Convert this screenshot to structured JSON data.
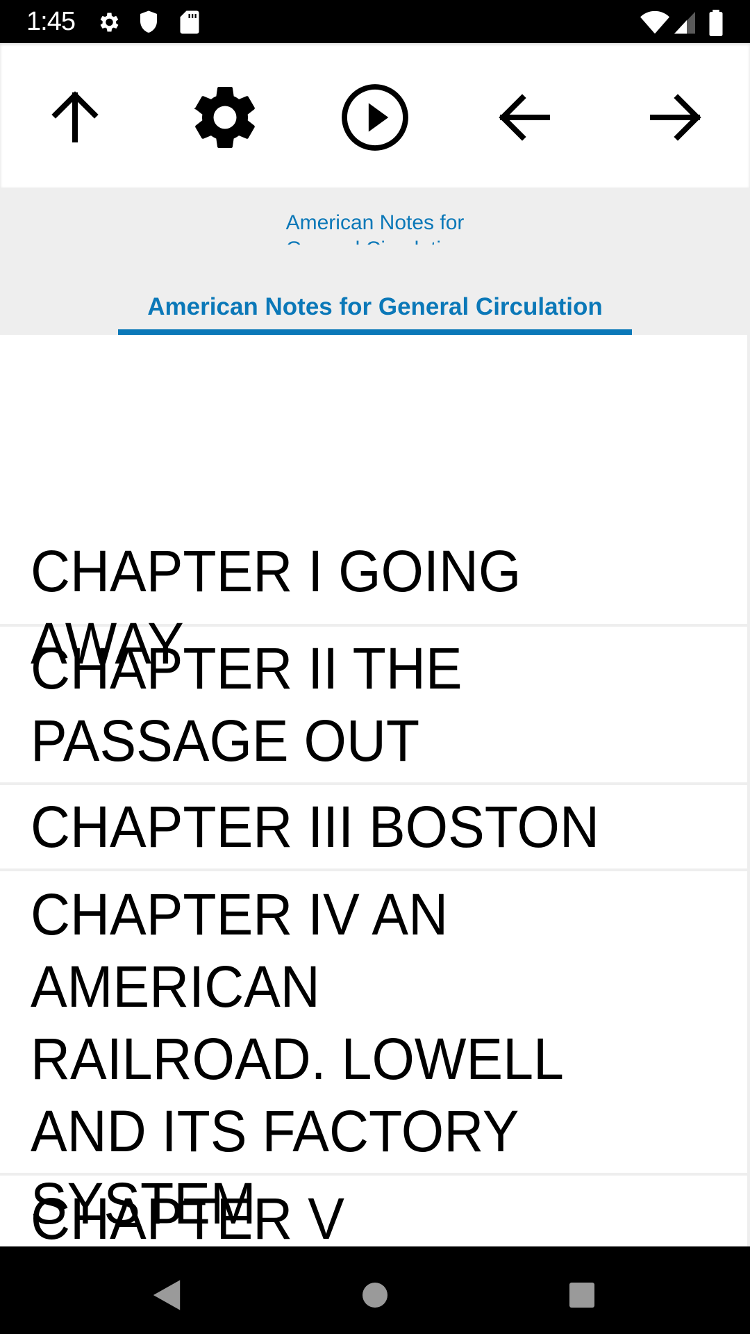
{
  "status_bar": {
    "time": "1:45",
    "left_icons": [
      "settings-icon",
      "shield-icon",
      "sd-card-icon"
    ],
    "right_icons": [
      "wifi-icon",
      "signal-icon",
      "battery-icon"
    ]
  },
  "toolbar": {
    "buttons": [
      {
        "name": "up",
        "icon": "arrow-up-icon"
      },
      {
        "name": "settings",
        "icon": "gear-icon"
      },
      {
        "name": "play",
        "icon": "play-circle-icon"
      },
      {
        "name": "back",
        "icon": "arrow-left-icon"
      },
      {
        "name": "forward",
        "icon": "arrow-right-icon"
      }
    ]
  },
  "header": {
    "small_title": "American Notes for General Circulation",
    "tab_label": "American Notes for General Circulation",
    "accent_color": "#0b78b8"
  },
  "chapters": [
    {
      "title": "CHAPTER I GOING AWAY"
    },
    {
      "title": "CHAPTER II THE PASSAGE OUT"
    },
    {
      "title": "CHAPTER III BOSTON"
    },
    {
      "title": "CHAPTER IV AN AMERICAN RAILROAD. LOWELL AND ITS FACTORY SYSTEM"
    },
    {
      "title": "CHAPTER V WORCESTER"
    }
  ],
  "nav_bar": {
    "buttons": [
      "back-icon",
      "home-icon",
      "recents-icon"
    ]
  }
}
